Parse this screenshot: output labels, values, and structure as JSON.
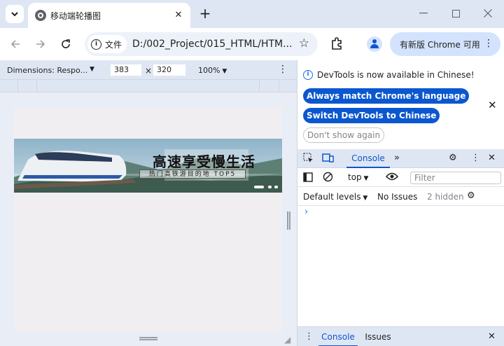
{
  "browser": {
    "tab_title": "移动端轮播图",
    "url": "D:/002_Project/015_HTML/HTM...",
    "site_chip_label": "文件",
    "update_label": "有新版 Chrome 可用"
  },
  "device_toolbar": {
    "dimensions_label": "Dimensions: Respo...",
    "width": "383",
    "height": "320",
    "times": "×",
    "zoom": "100%"
  },
  "banner": {
    "title": "高速享受慢生活",
    "subtitle": "热门高铁游目的地 TOP5",
    "slide_count": 3,
    "active_slide": 1
  },
  "devtools": {
    "notice": "DevTools is now available in Chinese!",
    "btn_match": "Always match Chrome's language",
    "btn_switch": "Switch DevTools to Chinese",
    "btn_dont_show": "Don't show again",
    "tab_console": "Console",
    "context": "top",
    "filter_placeholder": "Filter",
    "levels": "Default levels",
    "issues": "No Issues",
    "hidden": "2 hidden",
    "drawer_console": "Console",
    "drawer_issues": "Issues"
  },
  "colors": {
    "accent": "#0b57d0",
    "chrome_frame": "#dfe6f3"
  }
}
